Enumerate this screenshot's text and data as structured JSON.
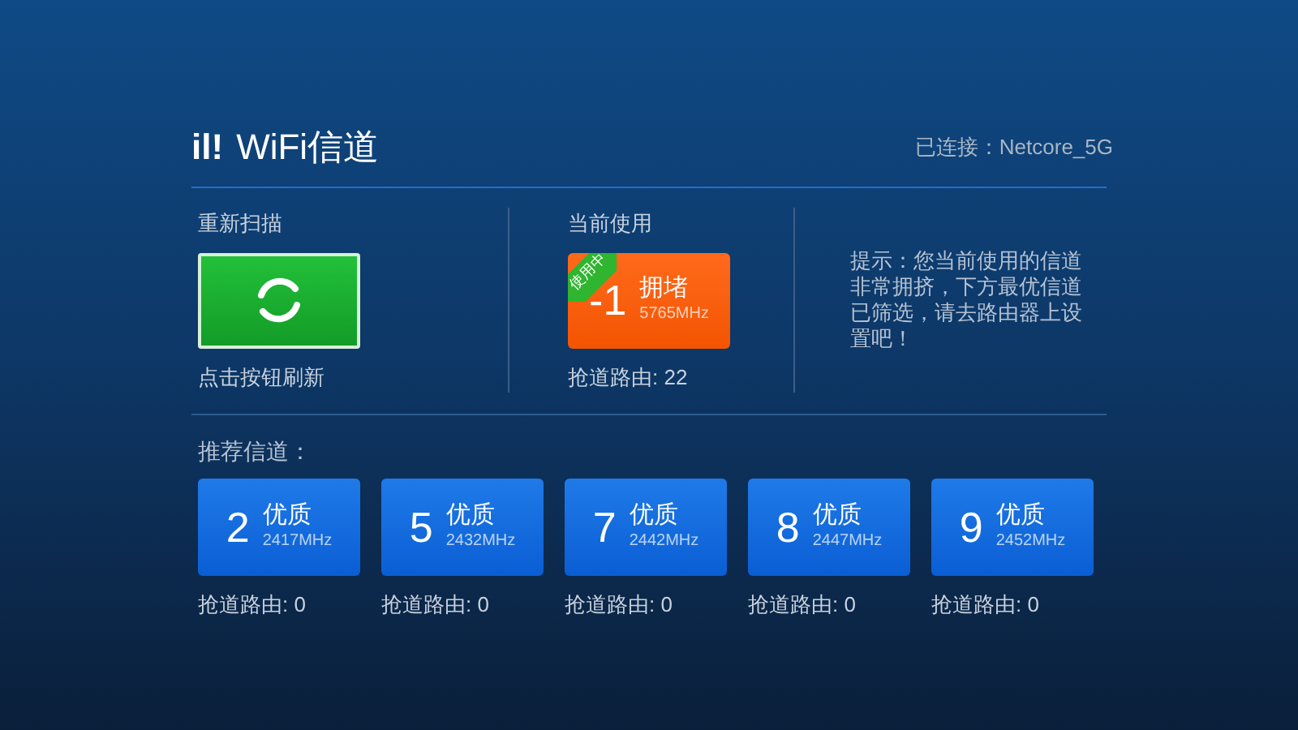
{
  "header": {
    "logo": "il!",
    "title": "WiFi信道",
    "connection": "已连接：Netcore_5G"
  },
  "rescan": {
    "label": "重新扫描",
    "hint": "点击按钮刷新"
  },
  "current": {
    "label": "当前使用",
    "channel": {
      "number": "-1",
      "quality": "拥堵",
      "frequency": "5765MHz",
      "kind": "congested",
      "badge": "使用中",
      "routers": "抢道路由: 22"
    }
  },
  "tip": "提示：您当前使用的信道非常拥挤，下方最优信道已筛选，请去路由器上设置吧！",
  "recommended": {
    "label": "推荐信道：",
    "channels": [
      {
        "number": "2",
        "quality": "优质",
        "frequency": "2417MHz",
        "kind": "good",
        "routers": "抢道路由: 0"
      },
      {
        "number": "5",
        "quality": "优质",
        "frequency": "2432MHz",
        "kind": "good",
        "routers": "抢道路由: 0"
      },
      {
        "number": "7",
        "quality": "优质",
        "frequency": "2442MHz",
        "kind": "good",
        "routers": "抢道路由: 0"
      },
      {
        "number": "8",
        "quality": "优质",
        "frequency": "2447MHz",
        "kind": "good",
        "routers": "抢道路由: 0"
      },
      {
        "number": "9",
        "quality": "优质",
        "frequency": "2452MHz",
        "kind": "good",
        "routers": "抢道路由: 0"
      }
    ]
  }
}
